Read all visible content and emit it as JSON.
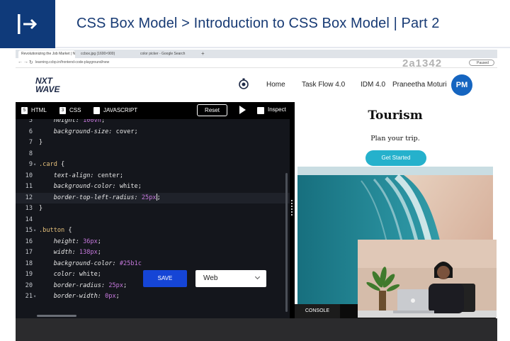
{
  "banner": {
    "title": "CSS Box Model > Introduction to CSS Box Model | Part 2"
  },
  "browser": {
    "tabs": [
      "Revolutionizing the Job Market | NxtWave",
      "ccbox.jpg (1600×900)",
      "color picker - Google Search"
    ],
    "new_tab": "+",
    "url": "learning.ccbp.in/frontend-code-playground/new",
    "paused_label": "Paused",
    "watermark": "2a1342"
  },
  "site": {
    "brand_line1": "NXT",
    "brand_line2": "WAVE",
    "nav": [
      "Home",
      "Task Flow 4.0",
      "IDM 4.0",
      "Praneetha Moturi"
    ],
    "avatar_initials": "PM"
  },
  "editor_toolbar": {
    "tabs": [
      {
        "label": "HTML",
        "icon": "html5-icon"
      },
      {
        "label": "CSS",
        "icon": "css3-icon"
      },
      {
        "label": "JAVASCRIPT",
        "icon": "js-file-icon"
      }
    ],
    "reset_label": "Reset",
    "inspect_label": "Inspect"
  },
  "code_lines": [
    {
      "n": "5",
      "fold": "",
      "parts": [
        [
          "prop",
          "    height: "
        ],
        [
          "num",
          "100vh"
        ],
        [
          "plain",
          ";"
        ]
      ]
    },
    {
      "n": "6",
      "fold": "",
      "parts": [
        [
          "prop",
          "    background-size: "
        ],
        [
          "val",
          "cover"
        ],
        [
          "plain",
          ";"
        ]
      ]
    },
    {
      "n": "7",
      "fold": "",
      "parts": [
        [
          "plain",
          "}"
        ]
      ]
    },
    {
      "n": "8",
      "fold": "",
      "parts": []
    },
    {
      "n": "9",
      "fold": "▾",
      "parts": [
        [
          "sel",
          ".card"
        ],
        [
          "plain",
          " {"
        ]
      ]
    },
    {
      "n": "10",
      "fold": "",
      "parts": [
        [
          "prop",
          "    text-align: "
        ],
        [
          "val",
          "center"
        ],
        [
          "plain",
          ";"
        ]
      ]
    },
    {
      "n": "11",
      "fold": "",
      "parts": [
        [
          "prop",
          "    background-color: "
        ],
        [
          "val",
          "white"
        ],
        [
          "plain",
          ";"
        ]
      ]
    },
    {
      "n": "12",
      "fold": "",
      "parts": [
        [
          "prop",
          "    border-top-left-radius: "
        ],
        [
          "num",
          "25px"
        ],
        [
          "cursor",
          ""
        ],
        [
          "plain",
          ";"
        ]
      ],
      "highlight": true
    },
    {
      "n": "13",
      "fold": "",
      "parts": [
        [
          "plain",
          "}"
        ]
      ]
    },
    {
      "n": "14",
      "fold": "",
      "parts": []
    },
    {
      "n": "15",
      "fold": "▾",
      "parts": [
        [
          "sel",
          ".button"
        ],
        [
          "plain",
          " {"
        ]
      ]
    },
    {
      "n": "16",
      "fold": "",
      "parts": [
        [
          "prop",
          "    height: "
        ],
        [
          "num",
          "36px"
        ],
        [
          "plain",
          ";"
        ]
      ]
    },
    {
      "n": "17",
      "fold": "",
      "parts": [
        [
          "prop",
          "    width: "
        ],
        [
          "num",
          "138px"
        ],
        [
          "plain",
          ";"
        ]
      ]
    },
    {
      "n": "18",
      "fold": "",
      "parts": [
        [
          "prop",
          "    background-color: "
        ],
        [
          "hex",
          "#25b1c"
        ]
      ]
    },
    {
      "n": "19",
      "fold": "",
      "parts": [
        [
          "prop",
          "    color: "
        ],
        [
          "val",
          "white"
        ],
        [
          "plain",
          ";"
        ]
      ]
    },
    {
      "n": "20",
      "fold": "",
      "parts": [
        [
          "prop",
          "    border-radius: "
        ],
        [
          "num",
          "25px"
        ],
        [
          "plain",
          ";"
        ]
      ]
    },
    {
      "n": "21",
      "fold": "▾",
      "parts": [
        [
          "prop",
          "    border-width: "
        ],
        [
          "num",
          "0px"
        ],
        [
          "plain",
          ";"
        ]
      ]
    }
  ],
  "overlay": {
    "save_label": "SAVE",
    "select_value": "Web"
  },
  "preview": {
    "title": "Tourism",
    "subtitle": "Plan your trip.",
    "button_label": "Get Started",
    "console_label": "CONSOLE"
  },
  "colors": {
    "banner_blue": "#0f3a7a",
    "title_blue": "#173a74",
    "accent_button": "#25b1cc",
    "save_blue": "#1545d6",
    "avatar_blue": "#1565c0"
  }
}
